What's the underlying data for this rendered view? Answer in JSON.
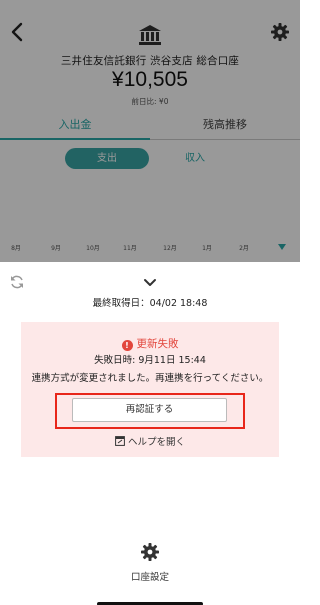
{
  "header": {
    "account_name": "三井住友信託銀行 渋谷支店 総合口座",
    "balance": "¥10,505",
    "prev_diff": "前日比: ¥0"
  },
  "tabs": [
    {
      "label": "入出金",
      "active": true
    },
    {
      "label": "残高推移",
      "active": false
    }
  ],
  "segment": {
    "out_label": "支出",
    "in_label": "収入"
  },
  "chart_months": [
    "8月",
    "9月",
    "10月",
    "11月",
    "12月",
    "1月",
    "2月"
  ],
  "sheet": {
    "last_fetch": "最終取得日：04/02 18:48",
    "error": {
      "title": "更新失敗",
      "icon": "!",
      "time": "失敗日時: 9月11日 15:44",
      "message": "連携方式が変更されました。再連携を行ってください。",
      "reauth_label": "再認証する",
      "help_label": "ヘルプを開く"
    },
    "settings_label": "口座設定"
  },
  "colors": {
    "accent": "#2aa8a8",
    "error": "#e2463c",
    "error_bg": "#fde8e8",
    "highlight": "#e8261a"
  }
}
